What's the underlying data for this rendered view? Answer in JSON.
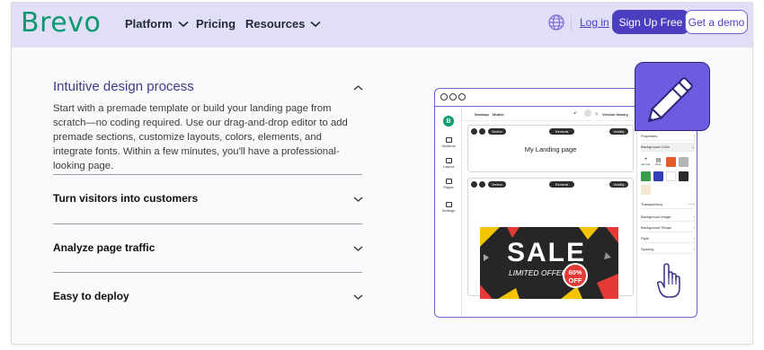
{
  "nav": {
    "logo": "Brevo",
    "links": [
      "Platform",
      "Pricing",
      "Resources"
    ],
    "login": "Log in",
    "signup": "Sign Up Free",
    "demo": "Get a demo",
    "globe_icon": "globe-icon"
  },
  "accordion": {
    "open": {
      "title": "Intuitive design process",
      "text": "Start with a premade template or build your landing page from scratch—no coding required. Use our drag-and-drop editor to add premade sections, customize layouts, colors, elements, and integrate fonts. Within a few minutes, you'll have a professional-looking page."
    },
    "closed": [
      "Turn visitors into customers",
      "Analyze page traffic",
      "Easy to deploy"
    ]
  },
  "mockup": {
    "sidebar": [
      "Sections",
      "Layout",
      "Pages",
      "Settings"
    ],
    "topbar": {
      "left": [
        "Desktop",
        "Mobile"
      ],
      "right": "Version history"
    },
    "toolbar": {
      "section": "Section",
      "elements": "Elements",
      "visibility": "Visibility"
    },
    "landing_title": "My Landing page",
    "sale": {
      "big": "SALE",
      "sub": "LIMITED OFFER",
      "badge_pct": "60%",
      "badge_off": "OFF"
    },
    "panel": {
      "title": "Edit section",
      "rows": [
        "Properties",
        "Background Color"
      ],
      "swatch_labels": [
        "add color",
        "library"
      ],
      "transparency": "Transparency",
      "more": [
        "Background image",
        "Background Shape",
        "Style",
        "Spacing"
      ]
    }
  },
  "colors": {
    "brand": "#0b996e",
    "accent": "#4c3fbf",
    "nav_bg": "#e0dff5"
  }
}
